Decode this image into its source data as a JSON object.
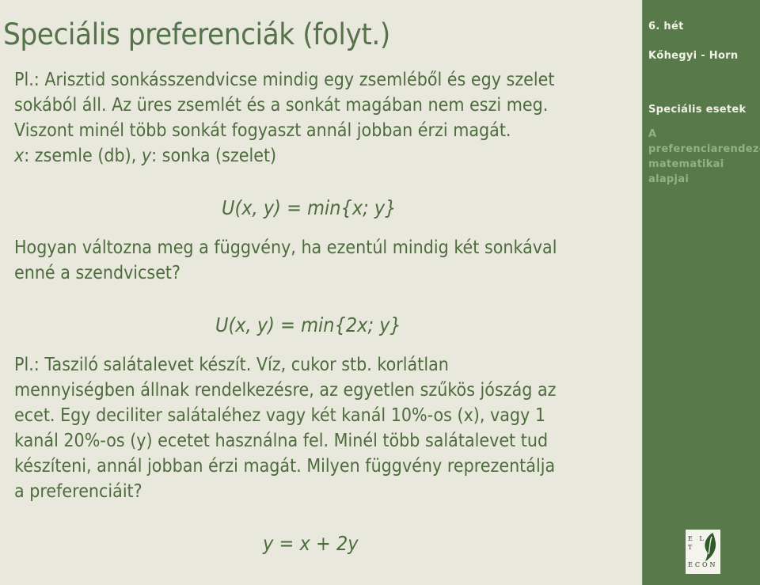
{
  "slide": {
    "title": "Speciális preferenciák (folyt.)",
    "para1": [
      "Pl.: Arisztid sonkásszendvicse mindig egy zsemléből és egy szelet",
      "sokából áll. Az üres zsemlét és a sonkát magában nem eszi meg.",
      "Viszont minél több sonkát fogyaszt annál jobban érzi magát."
    ],
    "vars_line": {
      "x": "x",
      "x_desc": ": zsemle (db), ",
      "y": "y",
      "y_desc": ": sonka (szelet)"
    },
    "formula1": "U(x, y) = min{x; y}",
    "question": [
      "Hogyan változna meg a függvény, ha ezentúl mindig két sonkával",
      "enné a szendvicset?"
    ],
    "formula2": "U(x, y) = min{2x; y}",
    "para2": [
      "Pl.: Tasziló salátalevet készít. Víz, cukor stb. korlátlan",
      "mennyiségben állnak rendelkezésre, az egyetlen szűkös jószág az",
      "ecet. Egy deciliter salátaléhez vagy két kanál 10%-os (x), vagy 1",
      "kanál 20%-os (y) ecetet használna fel. Minél több salátalevet tud",
      "készíteni, annál jobban érzi magát. Milyen függvény reprezentálja",
      "a preferenciáit?"
    ],
    "formula3": "y = x + 2y"
  },
  "sidebar": {
    "week": "6. hét",
    "authors": "Kőhegyi - Horn",
    "section_current": "Speciális esetek",
    "section_next": [
      "A",
      "preferenciarendezés",
      "matematikai",
      "alapjai"
    ]
  },
  "logo": {
    "letters": [
      "E L",
      "T",
      "ECON"
    ],
    "name": "ELTE ECON",
    "leaf_color": "#2f5a2a",
    "accent": "#c9a640"
  },
  "colors": {
    "background": "#e8e8dc",
    "sidebar": "#587a4b",
    "text": "#4e6b3e"
  }
}
